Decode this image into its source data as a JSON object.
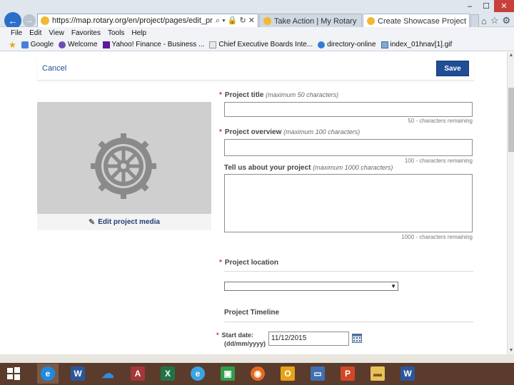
{
  "browser": {
    "url": "https://map.rotary.org/en/project/pages/edit_project.aspx",
    "tabs": [
      {
        "label": "Take Action | My Rotary"
      },
      {
        "label": "Create Showcase Project"
      }
    ],
    "menu": [
      "File",
      "Edit",
      "View",
      "Favorites",
      "Tools",
      "Help"
    ],
    "favorites": [
      {
        "label": "Google",
        "icon": "google-icon"
      },
      {
        "label": "Welcome",
        "icon": "msn-icon"
      },
      {
        "label": "Yahoo! Finance - Business ...",
        "icon": "yahoo-icon"
      },
      {
        "label": "Chief Executive Boards Inte...",
        "icon": "page-icon"
      },
      {
        "label": "directory-online",
        "icon": "ie-icon"
      },
      {
        "label": "index_01hnav[1].gif",
        "icon": "image-icon"
      }
    ]
  },
  "page": {
    "cancel_label": "Cancel",
    "save_label": "Save",
    "edit_media_label": "Edit project media",
    "fields": {
      "title": {
        "label": "Project title",
        "hint": "(maximum 50 characters)",
        "counter": "50 - characters remaining",
        "required": true
      },
      "overview": {
        "label": "Project overview",
        "hint": "(maximum 100 characters)",
        "counter": "100 - characters remaining",
        "required": true
      },
      "tell": {
        "label": "Tell us about your project",
        "hint": "(maximum 1000 characters)",
        "counter": "1000 - characters remaining",
        "required": false
      },
      "location": {
        "label": "Project location",
        "required": true,
        "selected": ""
      },
      "timeline": {
        "label": "Project Timeline"
      },
      "start_date": {
        "label_line1": "Start date:",
        "label_line2": "(dd/mm/yyyy)",
        "value": "11/12/2015",
        "required": true
      }
    }
  },
  "colors": {
    "accent": "#1f4e96",
    "required": "#c0392b",
    "taskbar": "#5b3b2b"
  },
  "taskbar": {
    "items": [
      "windows-start",
      "internet-explorer",
      "word",
      "onedrive",
      "access",
      "excel",
      "ie-alt",
      "store",
      "firefox",
      "outlook",
      "remote-desktop",
      "powerpoint",
      "file-explorer",
      "word-alt"
    ]
  }
}
